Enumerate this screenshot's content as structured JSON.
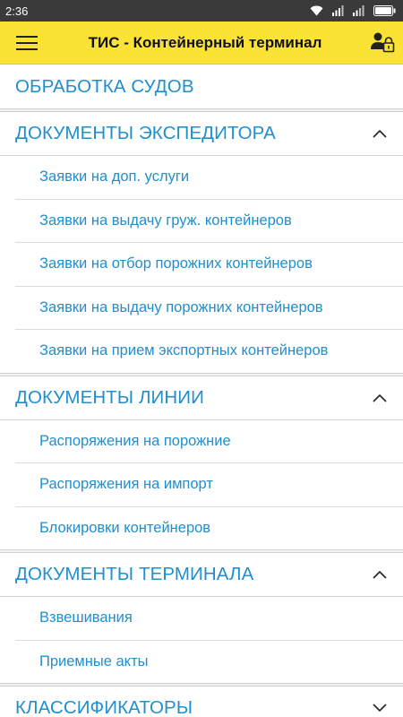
{
  "status_bar": {
    "time": "2:36"
  },
  "app_bar": {
    "title": "ТИС - Контейнерный терминал"
  },
  "sections": {
    "vessels": {
      "title": "ОБРАБОТКА СУДОВ"
    },
    "forwarder": {
      "title": "ДОКУМЕНТЫ ЭКСПЕДИТОРА",
      "expanded": true,
      "items": [
        "Заявки на доп. услуги",
        "Заявки на выдачу груж. контейнеров",
        "Заявки на отбор порожних контейнеров",
        "Заявки на выдачу порожних контейнеров",
        "Заявки на прием экспортных контейнеров"
      ]
    },
    "line": {
      "title": "ДОКУМЕНТЫ ЛИНИИ",
      "expanded": true,
      "items": [
        "Распоряжения на порожние",
        "Распоряжения на импорт",
        "Блокировки контейнеров"
      ]
    },
    "terminal": {
      "title": "ДОКУМЕНТЫ ТЕРМИНАЛА",
      "expanded": true,
      "items": [
        "Взвешивания",
        "Приемные акты"
      ]
    },
    "classifiers": {
      "title": "КЛАССИФИКАТОРЫ",
      "expanded": false
    }
  },
  "icons": {
    "menu": "hamburger-menu-icon",
    "user_lock": "user-lock-icon",
    "expanded": "chevron-up-icon",
    "collapsed": "chevron-down-icon"
  },
  "colors": {
    "app_bar": "#fbe336",
    "status_bar": "#3a3a3a",
    "accent_text": "#1f8fcf"
  }
}
